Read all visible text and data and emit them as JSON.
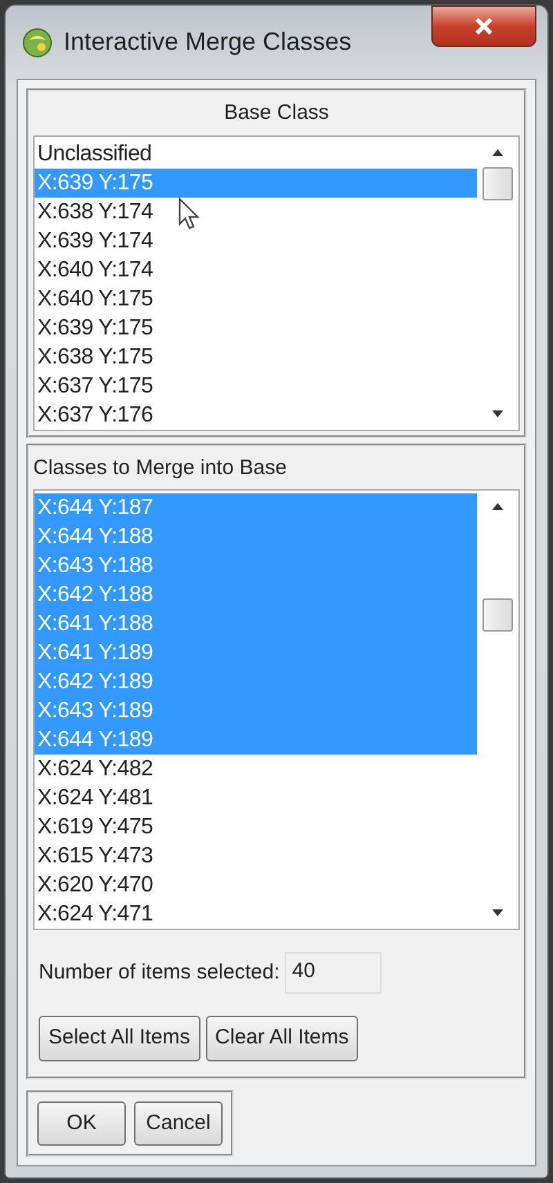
{
  "window": {
    "title": "Interactive Merge Classes"
  },
  "base_class": {
    "title": "Base Class",
    "items": [
      {
        "label": "Unclassified",
        "selected": false
      },
      {
        "label": "X:639 Y:175",
        "selected": true
      },
      {
        "label": "X:638 Y:174",
        "selected": false
      },
      {
        "label": "X:639 Y:174",
        "selected": false
      },
      {
        "label": "X:640 Y:174",
        "selected": false
      },
      {
        "label": "X:640 Y:175",
        "selected": false
      },
      {
        "label": "X:639 Y:175",
        "selected": false
      },
      {
        "label": "X:638 Y:175",
        "selected": false
      },
      {
        "label": "X:637 Y:175",
        "selected": false
      },
      {
        "label": "X:637 Y:176",
        "selected": false
      }
    ]
  },
  "merge_classes": {
    "title": "Classes to Merge into Base",
    "items": [
      {
        "label": "X:644 Y:187",
        "selected": true
      },
      {
        "label": "X:644 Y:188",
        "selected": true
      },
      {
        "label": "X:643 Y:188",
        "selected": true
      },
      {
        "label": "X:642 Y:188",
        "selected": true
      },
      {
        "label": "X:641 Y:188",
        "selected": true
      },
      {
        "label": "X:641 Y:189",
        "selected": true
      },
      {
        "label": "X:642 Y:189",
        "selected": true
      },
      {
        "label": "X:643 Y:189",
        "selected": true
      },
      {
        "label": "X:644 Y:189",
        "selected": true
      },
      {
        "label": "X:624 Y:482",
        "selected": false
      },
      {
        "label": "X:624 Y:481",
        "selected": false
      },
      {
        "label": "X:619 Y:475",
        "selected": false
      },
      {
        "label": "X:615 Y:473",
        "selected": false
      },
      {
        "label": "X:620 Y:470",
        "selected": false
      },
      {
        "label": "X:624 Y:471",
        "selected": false
      }
    ],
    "count_label": "Number of items selected:",
    "count_value": "40",
    "buttons": [
      "Select All Items",
      "Clear All Items"
    ]
  },
  "buttons": [
    "OK",
    "Cancel"
  ]
}
